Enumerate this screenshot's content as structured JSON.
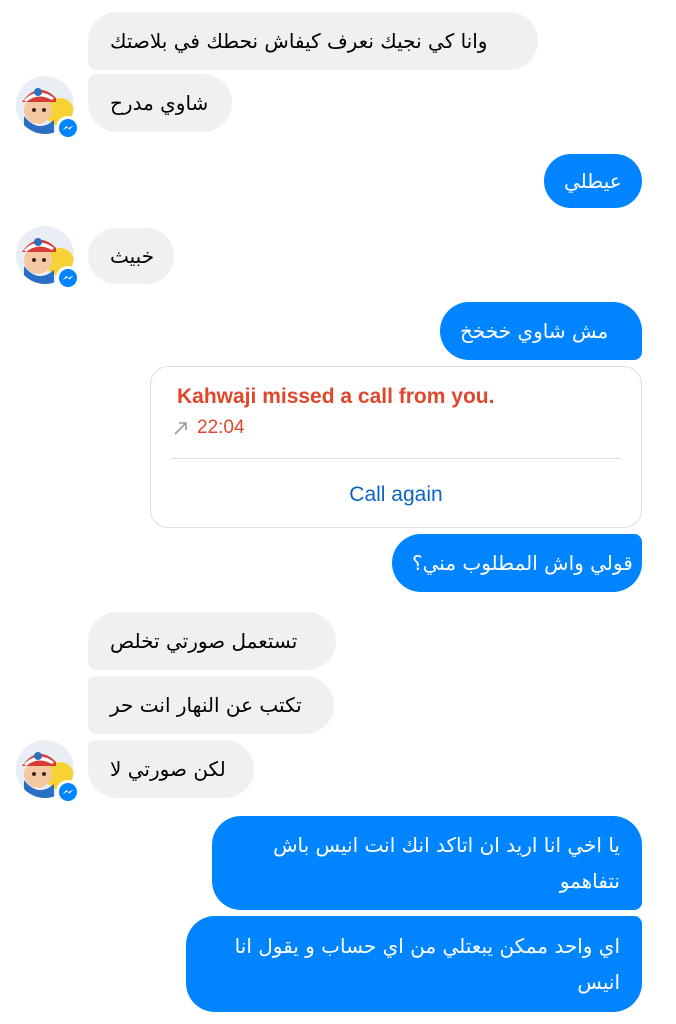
{
  "conversation": {
    "messages": [
      {
        "from": "them",
        "text": "وانا كي نجيك نعرف كيفاش نحطك في بلاصتك"
      },
      {
        "from": "them",
        "text": "شاوي مدرح"
      },
      {
        "from": "me",
        "text": "عيطلي"
      },
      {
        "from": "them",
        "text": "خبيث"
      },
      {
        "from": "me",
        "text": "مش شاوي خخخخ"
      },
      {
        "from": "me",
        "text": "قولي واش المطلوب مني؟"
      },
      {
        "from": "them",
        "text": "تستعمل صورتي تخلص"
      },
      {
        "from": "them",
        "text": "تكتب عن النهار انت حر"
      },
      {
        "from": "them",
        "text": "لكن صورتي لا"
      },
      {
        "from": "me",
        "text": "يا اخي انا اريد ان اتاكد انك انت انيس باش نتفاهمو"
      },
      {
        "from": "me",
        "text": "اي واحد ممكن يبعتلي من اي حساب و يقول انا انيس"
      }
    ],
    "missed_call": {
      "title": "Kahwaji missed a call from you.",
      "time": "22:04",
      "action_label": "Call again",
      "direction_icon": "outgoing-arrow-icon"
    }
  },
  "colors": {
    "outgoing_bubble": "#0084ff",
    "incoming_bubble": "#f0f0f0",
    "missed_call_text": "#e0472b",
    "link": "#0e63c7"
  }
}
